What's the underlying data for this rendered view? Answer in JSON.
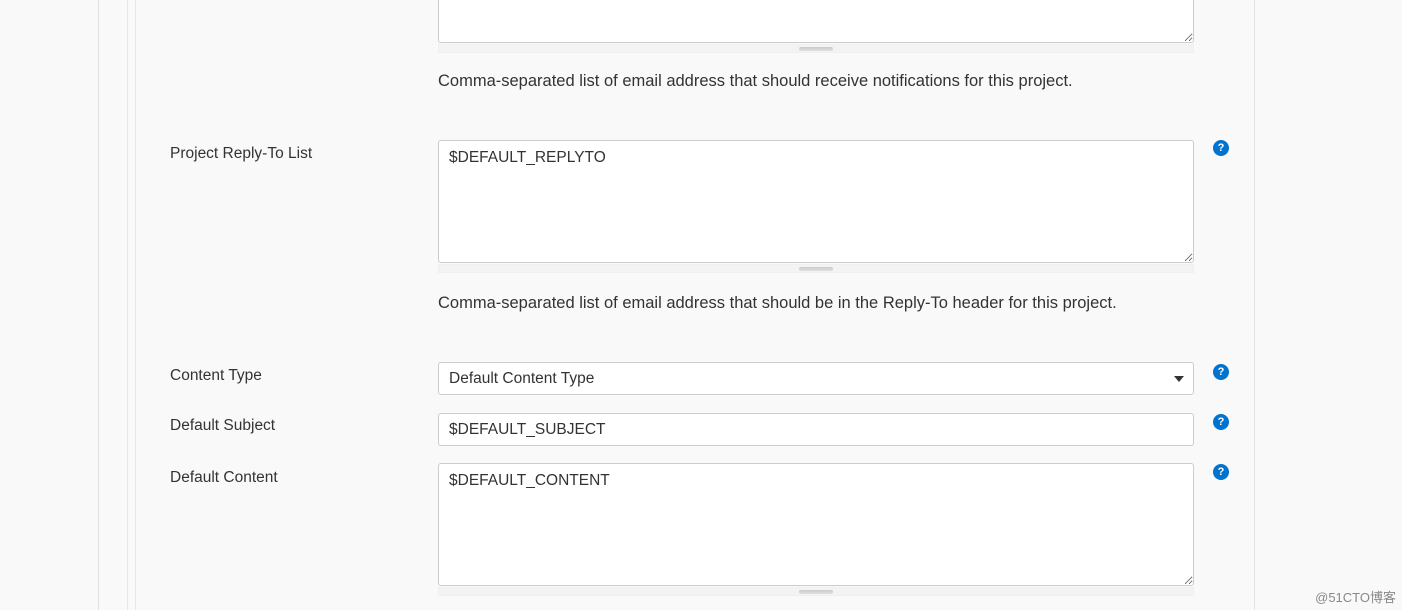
{
  "fields": {
    "recipientList": {
      "help": "Comma-separated list of email address that should receive notifications for this project."
    },
    "replyTo": {
      "label": "Project Reply-To List",
      "value": "$DEFAULT_REPLYTO",
      "help": "Comma-separated list of email address that should be in the Reply-To header for this project."
    },
    "contentType": {
      "label": "Content Type",
      "selected": "Default Content Type"
    },
    "defaultSubject": {
      "label": "Default Subject",
      "value": "$DEFAULT_SUBJECT"
    },
    "defaultContent": {
      "label": "Default Content",
      "value": "$DEFAULT_CONTENT"
    }
  },
  "watermark": "@51CTO博客"
}
